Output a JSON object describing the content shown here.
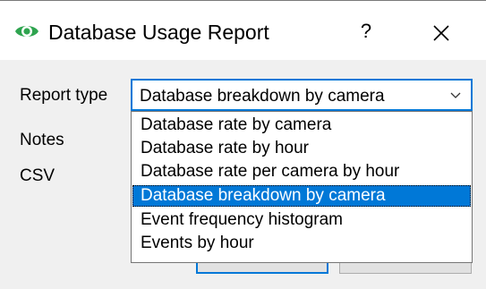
{
  "window": {
    "title": "Database Usage Report",
    "help_glyph": "?",
    "close_glyph": "✕",
    "app_icon": "eye-icon",
    "accent_color": "#0078d7",
    "icon_color": "#2ea44f"
  },
  "form": {
    "report_type_label": "Report type",
    "notes_label": "Notes",
    "csv_label": "CSV"
  },
  "report_type_select": {
    "selected_value": "Database breakdown by camera",
    "chevron_icon": "chevron-down-icon",
    "options": [
      "Database rate by camera",
      "Database rate by hour",
      "Database rate per camera by hour",
      "Database breakdown by camera",
      "Event frequency histogram",
      "Events by hour"
    ],
    "highlighted_option": "Database breakdown by camera"
  }
}
